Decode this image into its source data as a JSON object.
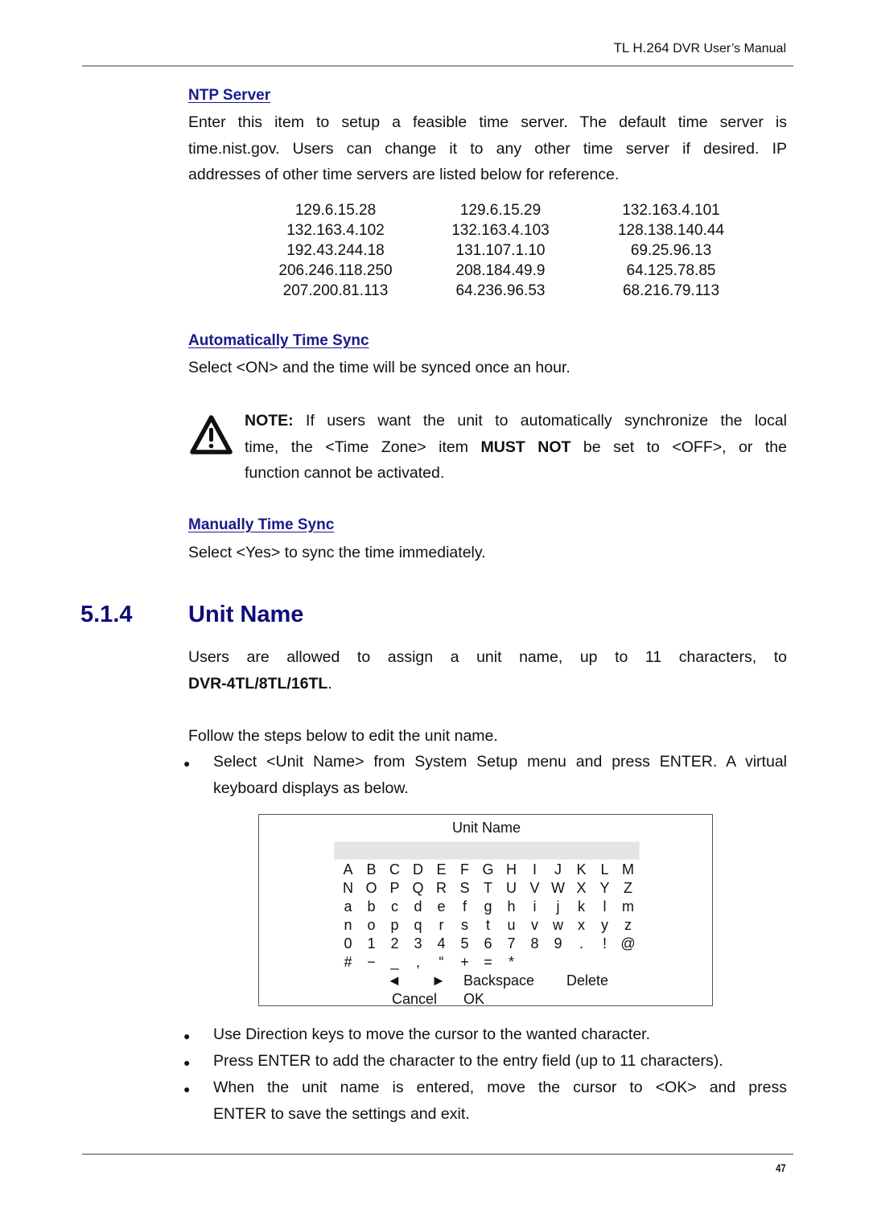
{
  "header": {
    "title_part1": "TL H.264",
    "title_part2": " DVR User’s Manual"
  },
  "ntp": {
    "heading": "NTP Server",
    "paragraph_lines": [
      "Enter this item to setup a feasible time server. The default time server is",
      "time.nist.gov. Users can change it to any other time server if desired. IP",
      "addresses of other time servers are listed below for reference."
    ],
    "servers": [
      [
        "129.6.15.28",
        "129.6.15.29",
        "132.163.4.101"
      ],
      [
        "132.163.4.102",
        "132.163.4.103",
        "128.138.140.44"
      ],
      [
        "192.43.244.18",
        "131.107.1.10",
        "69.25.96.13"
      ],
      [
        "206.246.118.250",
        "208.184.49.9",
        "64.125.78.85"
      ],
      [
        "207.200.81.113",
        "64.236.96.53",
        "68.216.79.113"
      ]
    ]
  },
  "auto_sync": {
    "heading": "Automatically Time Sync",
    "text": "Select <ON> and the time will be synced once an hour."
  },
  "note": {
    "icon": "warning-icon",
    "label": "NOTE:",
    "line1_rest": " If users want the unit to automatically synchronize the local",
    "line2_pre": "time, the <Time Zone> item ",
    "line2_bold": "MUST NOT",
    "line2_post": " be set to <OFF>, or the",
    "line3": "function cannot be activated."
  },
  "manual_sync": {
    "heading": "Manually Time Sync",
    "text": "Select <Yes> to sync the time immediately."
  },
  "section": {
    "number": "5.1.4",
    "title": "Unit Name",
    "intro_line1": "Users are allowed to assign a unit name, up to 11 characters, to",
    "intro_bold": "DVR-4TL/8TL/16TL",
    "intro_end": ".",
    "follow": "Follow the steps below to edit the unit name.",
    "bullet1_line1": "Select <Unit Name> from System Setup menu and press ENTER. A virtual",
    "bullet1_line2": "keyboard displays as below.",
    "bullet2": "Use Direction keys to move the cursor to the wanted character.",
    "bullet3": "Press ENTER to add the character to the entry field (up to 11 characters).",
    "bullet4_line1": "When the unit name is entered, move the cursor to <OK> and press",
    "bullet4_line2": "ENTER to save the settings and exit.",
    "bullet_glyph": "●"
  },
  "keyboard": {
    "title": "Unit Name",
    "field_value": "",
    "rows": [
      [
        "A",
        "B",
        "C",
        "D",
        "E",
        "F",
        "G",
        "H",
        "I",
        "J",
        "K",
        "L",
        "M"
      ],
      [
        "N",
        "O",
        "P",
        "Q",
        "R",
        "S",
        "T",
        "U",
        "V",
        "W",
        "X",
        "Y",
        "Z"
      ],
      [
        "a",
        "b",
        "c",
        "d",
        "e",
        "f",
        "g",
        "h",
        "i",
        "j",
        "k",
        "l",
        "m"
      ],
      [
        "n",
        "o",
        "p",
        "q",
        "r",
        "s",
        "t",
        "u",
        "v",
        "w",
        "x",
        "y",
        "z"
      ],
      [
        "0",
        "1",
        "2",
        "3",
        "4",
        "5",
        "6",
        "7",
        "8",
        "9",
        ".",
        "!",
        "@"
      ],
      [
        "#",
        "−",
        "_",
        ",",
        "“",
        "+",
        "=",
        "*"
      ]
    ],
    "left_arrow": "◄",
    "right_arrow": "►",
    "backspace": "Backspace",
    "delete": "Delete",
    "cancel": "Cancel",
    "ok": "OK"
  },
  "footer": {
    "page_number": "47"
  }
}
